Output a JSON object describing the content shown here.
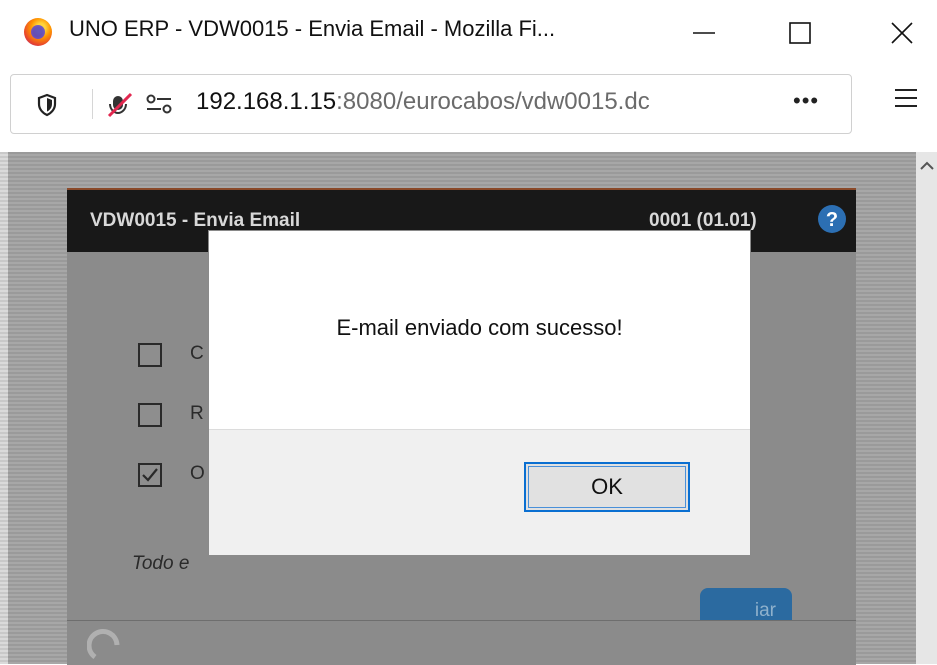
{
  "window": {
    "title": "UNO ERP - VDW0015 - Envia Email - Mozilla Fi...",
    "controls": [
      "minimize",
      "maximize",
      "close"
    ]
  },
  "navbar": {
    "url_host": "192.168.1.15",
    "url_rest": ":8080/eurocabos/vdw0015.dc",
    "more_label": "•••"
  },
  "app": {
    "title": "VDW0015 - Envia Email",
    "version": "0001 (01.01)",
    "help_label": "?",
    "checkboxes": [
      {
        "label": "C",
        "checked": false
      },
      {
        "label": "R",
        "checked": false
      },
      {
        "label": "O",
        "checked": true
      }
    ],
    "note": "Todo e",
    "send_button_label": "iar"
  },
  "dialog": {
    "message": "E-mail enviado com sucesso!",
    "ok_label": "OK"
  },
  "colors": {
    "app_header": "#181818",
    "accent_blue": "#0a6fd1",
    "send_button": "#2b6aa0"
  }
}
